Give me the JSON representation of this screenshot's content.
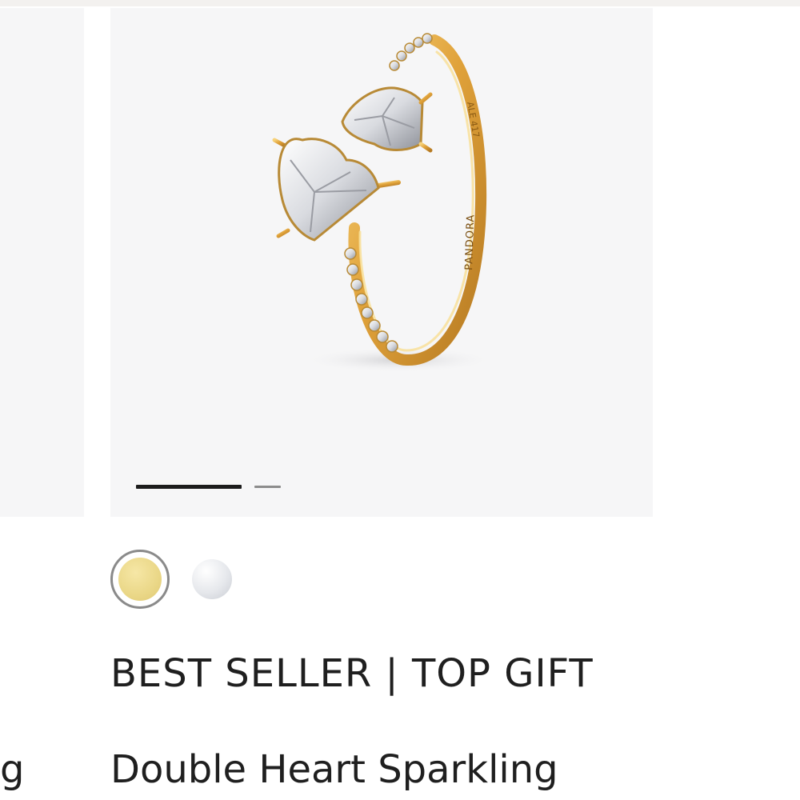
{
  "product": {
    "badge": "BEST SELLER | TOP GIFT",
    "name": "Double Heart Sparkling",
    "engraving_brand": "PANDORA",
    "engraving_alloy": "ALE 417"
  },
  "previous_card": {
    "name_fragment": "g"
  },
  "carousel": {
    "total_slides": 2,
    "active_slide": 1
  },
  "swatches": [
    {
      "metal": "gold",
      "color": "#ead787",
      "selected": true
    },
    {
      "metal": "silver",
      "color": "#e2e4e8",
      "selected": false
    }
  ],
  "colors": {
    "gold_metal": "#e2a33b",
    "image_background": "#f6f6f7",
    "text": "#1f1f1f"
  }
}
